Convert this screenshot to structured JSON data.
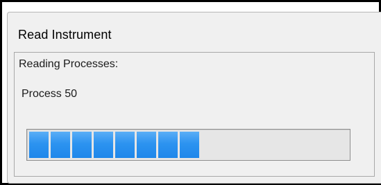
{
  "window": {
    "title": "Read Instrument"
  },
  "dialog": {
    "heading": "Reading Processes:",
    "status": "Process 50"
  },
  "progress": {
    "value_percent": 55,
    "segments_filled": 8,
    "color": "#2c93f0"
  }
}
